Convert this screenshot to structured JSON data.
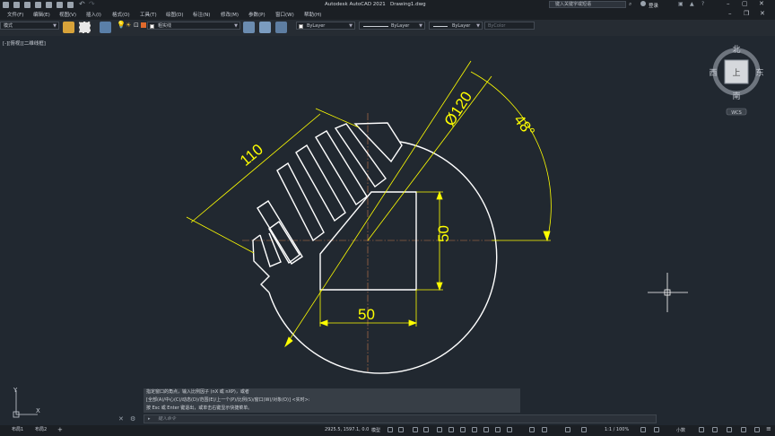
{
  "app": {
    "title": "Autodesk AutoCAD 2021",
    "file": "Drawing1.dwg",
    "search_placeholder": "键入关键字或短语",
    "user": "登录"
  },
  "menu": [
    "文件(F)",
    "编辑(E)",
    "视图(V)",
    "插入(I)",
    "格式(O)",
    "工具(T)",
    "绘图(D)",
    "标注(N)",
    "修改(M)",
    "参数(P)",
    "窗口(W)",
    "帮助(H)"
  ],
  "toolbar": {
    "workspace": "模式",
    "layer": "粗实线",
    "color": "ByLayer",
    "linetype": "ByLayer",
    "lineweight": "ByLayer",
    "plotstyle": "ByColor"
  },
  "viewport_label": "[-][俯视][二维线框]",
  "drawing": {
    "dim_length": "110",
    "dim_diameter": "Ø120",
    "dim_angle": "48°",
    "dim_height": "50",
    "dim_width": "50"
  },
  "viewcube": {
    "north": "北",
    "south": "南",
    "east": "东",
    "west": "西",
    "face": "上",
    "wcs": "WCS"
  },
  "ucs": {
    "x": "X",
    "y": "Y"
  },
  "command": {
    "history": [
      "指定窗口的角点，输入比例因子 (nX 或 nXP)，或者",
      "[全部(A)/中心(C)/动态(D)/范围(E)/上一个(P)/比例(S)/窗口(W)/对象(O)] <实时>:",
      "按 Esc 或 Enter 键退出，或单击右键显示快捷菜单。"
    ],
    "placeholder": "键入命令"
  },
  "layout_tabs": [
    "布局1",
    "布局2"
  ],
  "status": {
    "coords": "2925.5, 1597.1, 0.0",
    "model": "模型",
    "scale": "1:1 / 100%",
    "units": "小数"
  },
  "colors": {
    "background": "#212830",
    "geometry": "#ffffff",
    "dimension": "#ffff00",
    "centerline": "#c8784a"
  }
}
